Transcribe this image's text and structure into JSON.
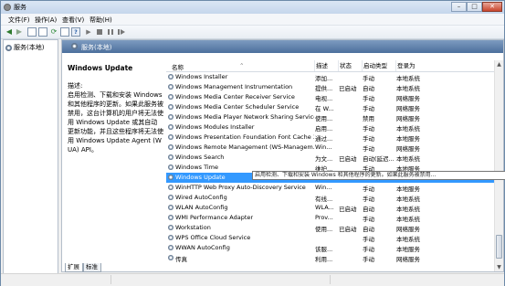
{
  "window": {
    "title": "服务"
  },
  "menu": [
    "文件(F)",
    "操作(A)",
    "查看(V)",
    "帮助(H)"
  ],
  "tree": {
    "root": "服务(本地)"
  },
  "panel": {
    "header": "服务(本地)",
    "selected_name": "Windows Update",
    "description_label": "描述:",
    "description": "启用检测、下载和安装 Windows 和其他程序的更新。如果此服务被禁用，这台计算机的用户将无法使用 Windows Update 或其自动更新功能，并且这些程序将无法使用 Windows Update Agent (WUA) API。"
  },
  "columns": {
    "name": "名称",
    "desc": "描述",
    "status": "状态",
    "startup": "启动类型",
    "logon": "登录为"
  },
  "services": [
    {
      "name": "Windows Installer",
      "desc": "添加...",
      "status": "",
      "startup": "手动",
      "logon": "本地系统"
    },
    {
      "name": "Windows Management Instrumentation",
      "desc": "提供...",
      "status": "已启动",
      "startup": "自动",
      "logon": "本地系统"
    },
    {
      "name": "Windows Media Center Receiver Service",
      "desc": "电视...",
      "status": "",
      "startup": "手动",
      "logon": "网络服务"
    },
    {
      "name": "Windows Media Center Scheduler Service",
      "desc": "在 W...",
      "status": "",
      "startup": "手动",
      "logon": "网络服务"
    },
    {
      "name": "Windows Media Player Network Sharing Service",
      "desc": "使用...",
      "status": "",
      "startup": "禁用",
      "logon": "网络服务"
    },
    {
      "name": "Windows Modules Installer",
      "desc": "启用...",
      "status": "",
      "startup": "手动",
      "logon": "本地系统"
    },
    {
      "name": "Windows Presentation Foundation Font Cache 3...",
      "desc": "通过...",
      "status": "",
      "startup": "手动",
      "logon": "本地服务"
    },
    {
      "name": "Windows Remote Management (WS-Managem...",
      "desc": "Win...",
      "status": "",
      "startup": "手动",
      "logon": "网络服务"
    },
    {
      "name": "Windows Search",
      "desc": "为文...",
      "status": "已启动",
      "startup": "自动(延迟...",
      "logon": "本地系统"
    },
    {
      "name": "Windows Time",
      "desc": "维护...",
      "status": "",
      "startup": "手动",
      "logon": "本地服务"
    },
    {
      "name": "Windows Update",
      "desc": "启用检测、下载和安装 Windows 和其他程序的更新。如果此服务被禁用...",
      "status": "",
      "startup": "",
      "logon": ""
    },
    {
      "name": "WinHTTP Web Proxy Auto-Discovery Service",
      "desc": "Win...",
      "status": "",
      "startup": "手动",
      "logon": "本地服务"
    },
    {
      "name": "Wired AutoConfig",
      "desc": "有线...",
      "status": "",
      "startup": "手动",
      "logon": "本地系统"
    },
    {
      "name": "WLAN AutoConfig",
      "desc": "WLA...",
      "status": "已启动",
      "startup": "自动",
      "logon": "本地系统"
    },
    {
      "name": "WMI Performance Adapter",
      "desc": "Prov...",
      "status": "",
      "startup": "手动",
      "logon": "本地系统"
    },
    {
      "name": "Workstation",
      "desc": "使用...",
      "status": "已启动",
      "startup": "自动",
      "logon": "网络服务"
    },
    {
      "name": "WPS Office Cloud Service",
      "desc": "",
      "status": "",
      "startup": "手动",
      "logon": "本地系统"
    },
    {
      "name": "WWAN AutoConfig",
      "desc": "该服...",
      "status": "",
      "startup": "手动",
      "logon": "本地服务"
    },
    {
      "name": "传真",
      "desc": "利用...",
      "status": "",
      "startup": "手动",
      "logon": "网络服务"
    }
  ],
  "selected_index": 10,
  "tooltip": "启用检测、下载和安装 Windows 和其他程序的更新。如果此服务被禁用...",
  "tabs": [
    "扩展",
    "标准"
  ],
  "colors": {
    "selection": "#3399ff",
    "header": "#4c6f9c"
  }
}
